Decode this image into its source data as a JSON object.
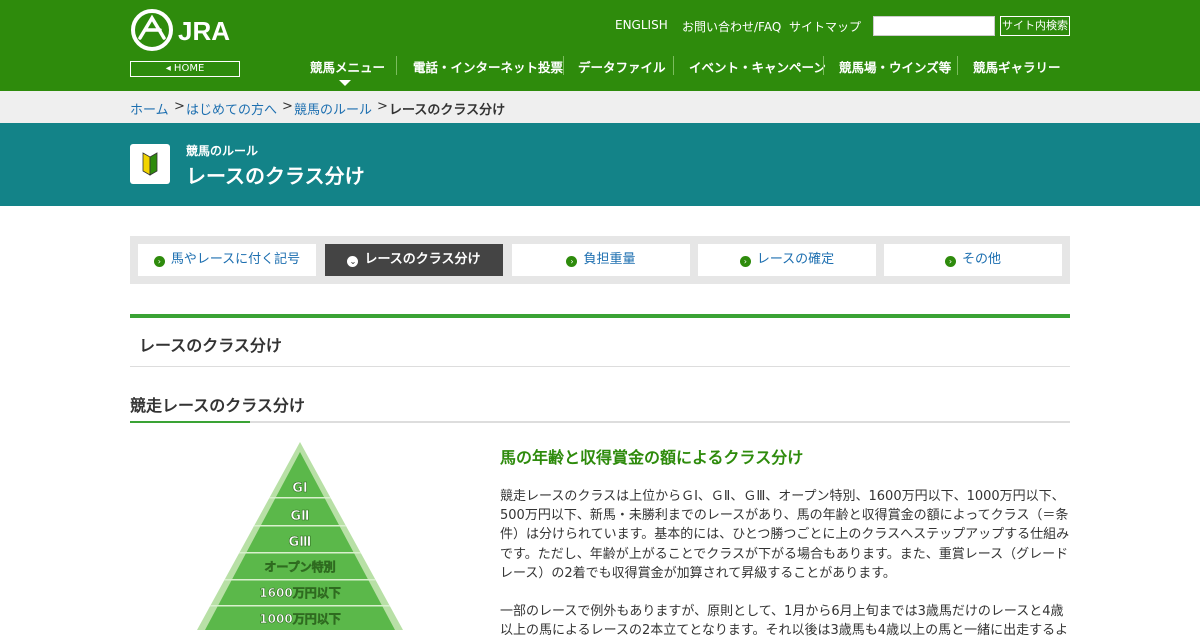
{
  "header": {
    "logo_text": "JRA",
    "home_label": "HOME",
    "util_links": [
      "ENGLISH",
      "お問い合わせ/FAQ",
      "サイトマップ"
    ],
    "search_placeholder": "",
    "search_button": "サイト内検索",
    "nav": [
      "競馬メニュー",
      "電話・インターネット投票",
      "データファイル",
      "イベント・キャンペーン",
      "競馬場・ウインズ等",
      "競馬ギャラリー"
    ]
  },
  "breadcrumb": {
    "items": [
      "ホーム",
      "はじめての方へ",
      "競馬のルール"
    ],
    "current": "レースのクラス分け"
  },
  "banner": {
    "subtitle": "競馬のルール",
    "title": "レースのクラス分け"
  },
  "tabs": [
    {
      "label": "馬やレースに付く記号",
      "active": false
    },
    {
      "label": "レースのクラス分け",
      "active": true
    },
    {
      "label": "負担重量",
      "active": false
    },
    {
      "label": "レースの確定",
      "active": false
    },
    {
      "label": "その他",
      "active": false
    }
  ],
  "section": {
    "title": "レースのクラス分け",
    "subtitle": "競走レースのクラス分け"
  },
  "pyramid": {
    "levels": [
      "GⅠ",
      "GⅡ",
      "GⅢ",
      "オープン特別",
      "1600万円以下",
      "1000万円以下"
    ]
  },
  "content": {
    "heading": "馬の年齢と収得賞金の額によるクラス分け",
    "para1": "競走レースのクラスは上位からＧⅠ、ＧⅡ、ＧⅢ、オープン特別、1600万円以下、1000万円以下、500万円以下、新馬・未勝利までのレースがあり、馬の年齢と収得賞金の額によってクラス（＝条件）は分けられています。基本的には、ひとつ勝つごとに上のクラスへステップアップする仕組みです。ただし、年齢が上がることでクラスが下がる場合もあります。また、重賞レース（グレードレース）の2着でも収得賞金が加算されて昇級することがあります。",
    "para2": "一部のレースで例外もありますが、原則として、1月から6月上旬までは3歳馬だけのレースと4歳以上の馬によるレースの2本立てとなります。それ以後は3歳馬も4歳以上の馬と一緒に出走するよ"
  },
  "colors": {
    "header_green": "#2e8b0c",
    "banner_teal": "#138388",
    "accent_green": "#3aa335",
    "link_blue": "#1d6fb0"
  }
}
